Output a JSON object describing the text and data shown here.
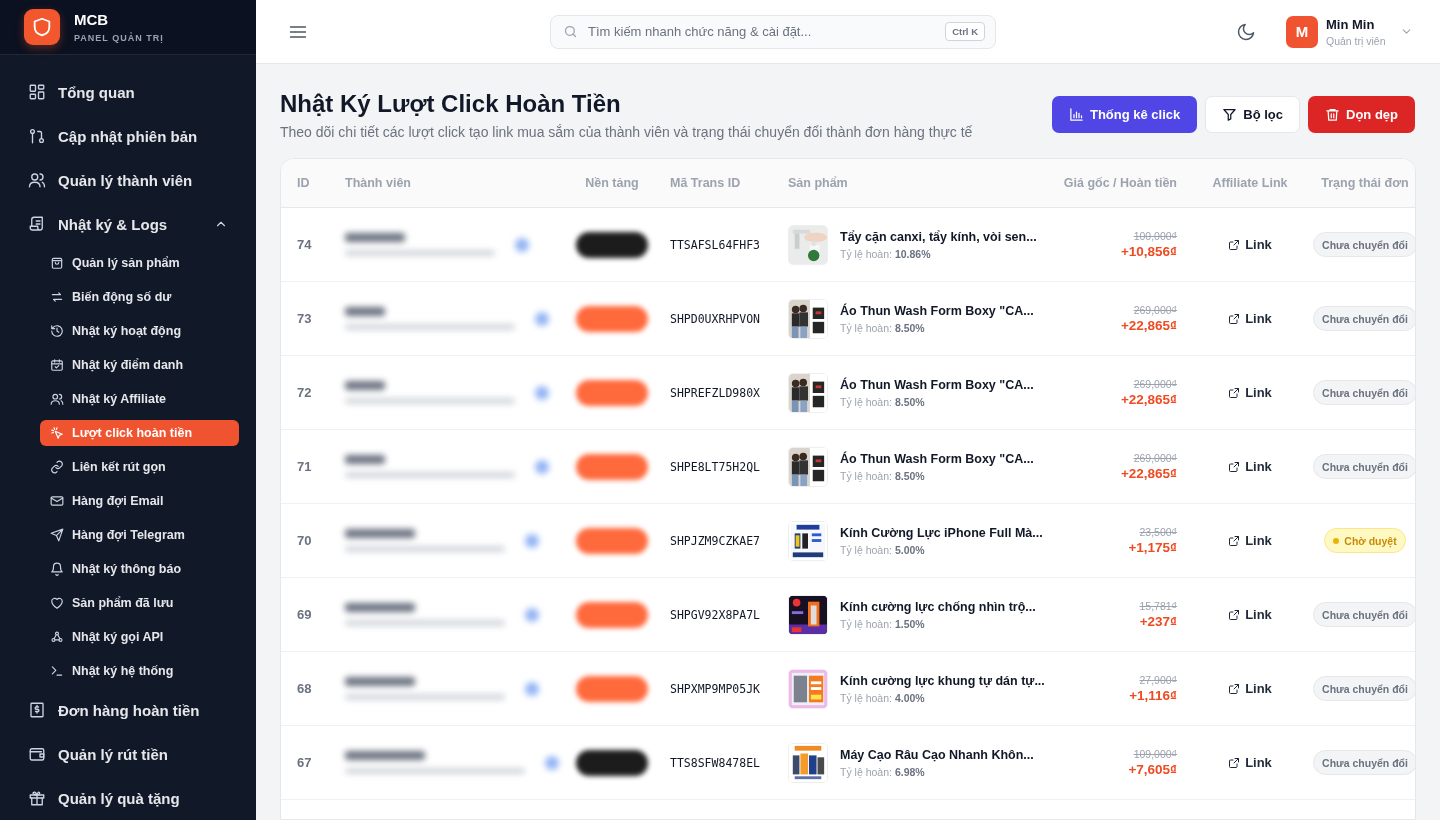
{
  "sidebar": {
    "brand": {
      "name": "MCB",
      "subtitle": "PANEL QUẢN TRỊ"
    },
    "items": [
      {
        "label": "Tổng quan",
        "selected": false
      },
      {
        "label": "Cập nhật phiên bản",
        "selected": false
      },
      {
        "label": "Quản lý thành viên",
        "selected": false
      },
      {
        "label": "Nhật ký & Logs",
        "selected": false,
        "expanded": true,
        "children": [
          {
            "label": "Quản lý sản phẩm",
            "selected": false
          },
          {
            "label": "Biến động số dư",
            "selected": false
          },
          {
            "label": "Nhật ký hoạt động",
            "selected": false
          },
          {
            "label": "Nhật ký điểm danh",
            "selected": false
          },
          {
            "label": "Nhật ký Affiliate",
            "selected": false
          },
          {
            "label": "Lượt click hoàn tiền",
            "selected": true
          },
          {
            "label": "Liên kết rút gọn",
            "selected": false
          },
          {
            "label": "Hàng đợi Email",
            "selected": false
          },
          {
            "label": "Hàng đợi Telegram",
            "selected": false
          },
          {
            "label": "Nhật ký thông báo",
            "selected": false
          },
          {
            "label": "Sản phẩm đã lưu",
            "selected": false
          },
          {
            "label": "Nhật ký gọi API",
            "selected": false
          },
          {
            "label": "Nhật ký hệ thống",
            "selected": false
          }
        ]
      },
      {
        "label": "Đơn hàng hoàn tiền",
        "selected": false
      },
      {
        "label": "Quản lý rút tiền",
        "selected": false
      },
      {
        "label": "Quản lý quà tặng",
        "selected": false
      }
    ]
  },
  "topbar": {
    "search": {
      "placeholder": "Tìm kiếm nhanh chức năng & cài đặt...",
      "shortcut": "Ctrl K"
    },
    "user": {
      "initial": "M",
      "name": "Min Min",
      "role": "Quản trị viên"
    }
  },
  "page": {
    "title": "Nhật Ký Lượt Click Hoàn Tiền",
    "subtitle": "Theo dõi chi tiết các lượt click tạo link mua sắm của thành viên và trạng thái chuyển đổi thành đơn hàng thực tế",
    "actions": [
      {
        "label": "Thống kê click",
        "kind": "primary"
      },
      {
        "label": "Bộ lọc",
        "kind": "filter"
      },
      {
        "label": "Dọn dẹp",
        "kind": "danger"
      }
    ]
  },
  "table": {
    "columns": [
      "ID",
      "Thành viên",
      "Nền tảng",
      "Mã Trans ID",
      "Sản phẩm",
      "Giá gốc / Hoàn tiền",
      "Affiliate Link",
      "Trạng thái đơn"
    ],
    "rows": [
      {
        "id": "74",
        "platform": {
          "color": "#1c1c1c"
        },
        "trans_id": "TTSAFSL64FHF3",
        "product": "Tẩy cặn canxi, tẩy kính, vòi sen...",
        "rate": "Tỷ lệ hoàn: **10.86%**",
        "price": "100,000₫",
        "cashback": "+10,856₫",
        "link": "Link",
        "status": {
          "label": "Chưa chuyển đổi",
          "kind": "unconverted"
        }
      },
      {
        "id": "73",
        "platform": {
          "color": "#ff6a3d"
        },
        "trans_id": "SHPD0UXRHPVON",
        "product": "Áo Thun Wash Form Boxy \"CA...",
        "rate": "Tỷ lệ hoàn: **8.50%**",
        "price": "269,000₫",
        "cashback": "+22,865₫",
        "link": "Link",
        "status": {
          "label": "Chưa chuyển đổi",
          "kind": "unconverted"
        }
      },
      {
        "id": "72",
        "platform": {
          "color": "#ff6a3d"
        },
        "trans_id": "SHPREFZLD980X",
        "product": "Áo Thun Wash Form Boxy \"CA...",
        "rate": "Tỷ lệ hoàn: **8.50%**",
        "price": "269,000₫",
        "cashback": "+22,865₫",
        "link": "Link",
        "status": {
          "label": "Chưa chuyển đổi",
          "kind": "unconverted"
        }
      },
      {
        "id": "71",
        "platform": {
          "color": "#ff6a3d"
        },
        "trans_id": "SHPE8LT75H2QL",
        "product": "Áo Thun Wash Form Boxy \"CA...",
        "rate": "Tỷ lệ hoàn: **8.50%**",
        "price": "269,000₫",
        "cashback": "+22,865₫",
        "link": "Link",
        "status": {
          "label": "Chưa chuyển đổi",
          "kind": "unconverted"
        }
      },
      {
        "id": "70",
        "platform": {
          "color": "#ff6a3d"
        },
        "trans_id": "SHPJZM9CZKAE7",
        "product": "Kính Cường Lực iPhone Full Mà...",
        "rate": "Tỷ lệ hoàn: **5.00%**",
        "price": "23,500₫",
        "cashback": "+1,175₫",
        "link": "Link",
        "status": {
          "label": "Chờ duyệt",
          "kind": "pending"
        }
      },
      {
        "id": "69",
        "platform": {
          "color": "#ff6a3d"
        },
        "trans_id": "SHPGV92X8PA7L",
        "product": "Kính cường lực chống nhìn trộ...",
        "rate": "Tỷ lệ hoàn: **1.50%**",
        "price": "15,781₫",
        "cashback": "+237₫",
        "link": "Link",
        "status": {
          "label": "Chưa chuyển đổi",
          "kind": "unconverted"
        }
      },
      {
        "id": "68",
        "platform": {
          "color": "#ff6a3d"
        },
        "trans_id": "SHPXMP9MP05JK",
        "product": "Kính cường lực khung tự dán tự...",
        "rate": "Tỷ lệ hoàn: **4.00%**",
        "price": "27,900₫",
        "cashback": "+1,116₫",
        "link": "Link",
        "status": {
          "label": "Chưa chuyển đổi",
          "kind": "unconverted"
        }
      },
      {
        "id": "67",
        "platform": {
          "color": "#1c1c1c"
        },
        "trans_id": "TTS8SFW8478EL",
        "product": "Máy Cạo Râu Cạo Nhanh Khôn...",
        "rate": "Tỷ lệ hoàn: **6.98%**",
        "price": "109,000₫",
        "cashback": "+7,605₫",
        "link": "Link",
        "status": {
          "label": "Chưa chuyển đổi",
          "kind": "unconverted"
        }
      }
    ]
  }
}
